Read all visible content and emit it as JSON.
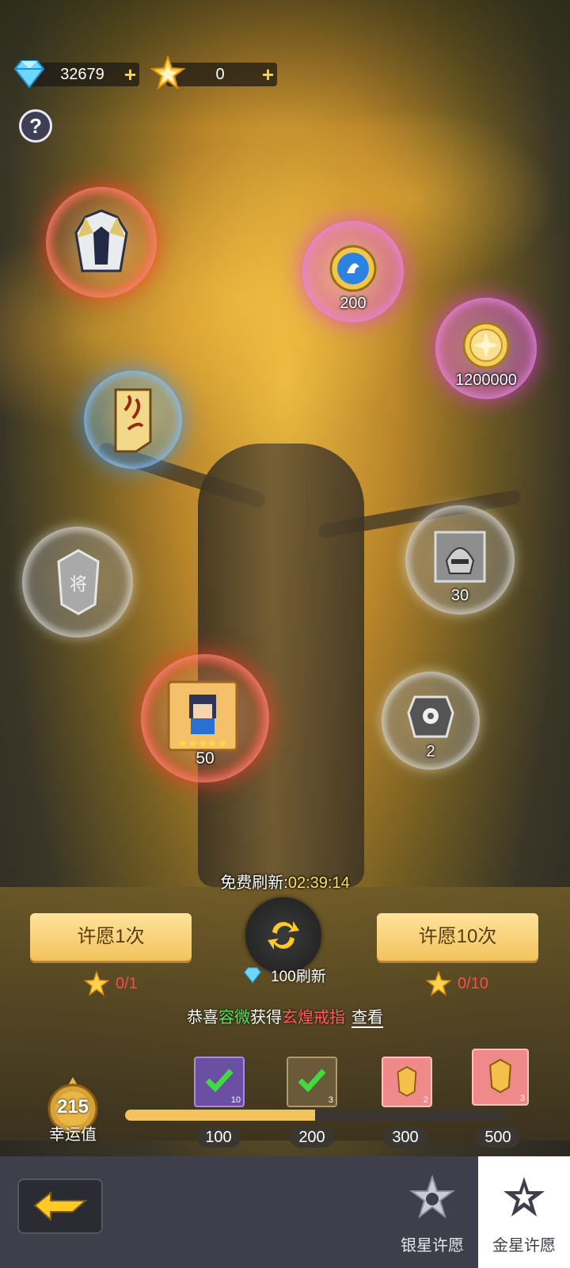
{
  "resources": {
    "diamonds": "32679",
    "stars": "0"
  },
  "bubbles": {
    "armor": {
      "count": ""
    },
    "pink_token": {
      "count": "200"
    },
    "gold_coin": {
      "count": "1200000"
    },
    "scroll": {
      "count": ""
    },
    "general_card": {
      "count": ""
    },
    "helmet_frag": {
      "count": "30"
    },
    "hero": {
      "count": "50"
    },
    "tag": {
      "count": "2"
    }
  },
  "refresh": {
    "label": "免费刷新:",
    "time": "02:39:14",
    "cost": "100刷新"
  },
  "wish": {
    "one": "许愿1次",
    "ten": "许愿10次",
    "one_cost": "0/1",
    "ten_cost": "0/10"
  },
  "news": {
    "prefix": "恭喜",
    "player": "容微",
    "mid": "获得",
    "item": "玄煌戒指",
    "view": "查看"
  },
  "luck": {
    "value": "215",
    "label": "幸运值",
    "progress": 0.5
  },
  "milestones": [
    {
      "value": "100",
      "count": "10",
      "claimed": true
    },
    {
      "value": "200",
      "count": "3",
      "claimed": true
    },
    {
      "value": "300",
      "count": "2",
      "claimed": false
    },
    {
      "value": "500",
      "count": "3",
      "claimed": false
    }
  ],
  "tabs": {
    "silver": "银星许愿",
    "gold": "金星许愿"
  },
  "colors": {
    "accent": "#f3c45b",
    "red": "#ff4a4a",
    "green": "#55e066"
  }
}
